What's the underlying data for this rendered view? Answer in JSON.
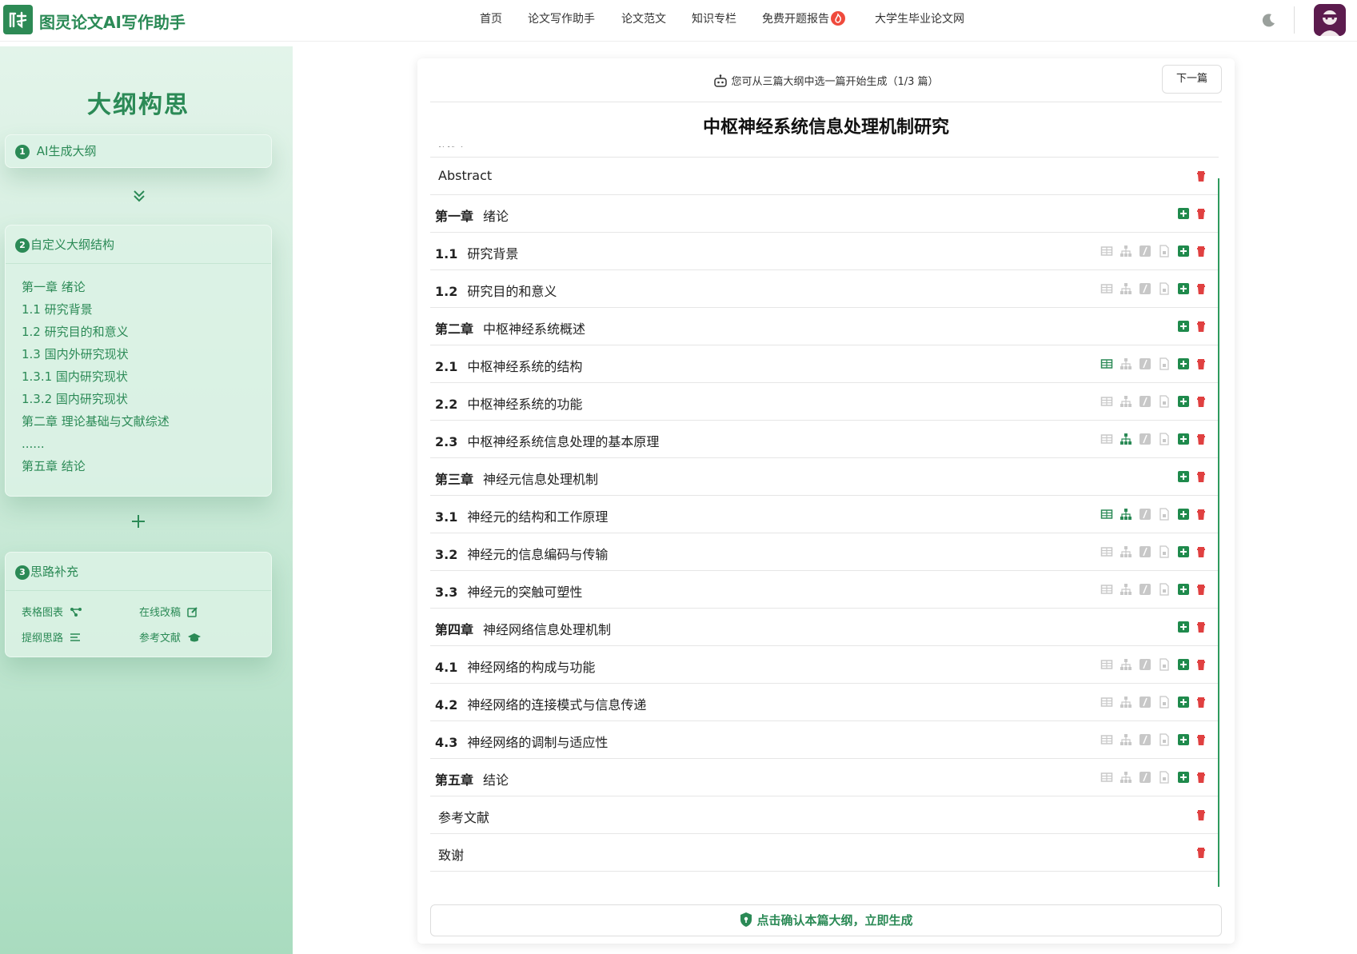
{
  "app": {
    "title": "图灵论文AI写作助手"
  },
  "nav": [
    "首页",
    "论文写作助手",
    "论文范文",
    "知识专栏",
    "免费开题报告",
    "大学生毕业论文网"
  ],
  "sidebar": {
    "title": "大纲构思",
    "step1": {
      "num": "1",
      "label": "AI生成大纲"
    },
    "step2": {
      "num": "2",
      "label": "自定义大纲结构",
      "items": [
        "第一章 绪论",
        "1.1 研究背景",
        "1.2 研究目的和意义",
        "1.3 国内外研究现状",
        "1.3.1 国内研究现状",
        "1.3.2 国内研究现状",
        "第二章 理论基础与文献综述",
        "......",
        "第五章 结论"
      ]
    },
    "step3": {
      "num": "3",
      "label": "思路补充",
      "links": [
        "表格图表",
        "在线改稿",
        "提纲思路",
        "参考文献"
      ]
    }
  },
  "main": {
    "hint": "您可从三篇大纲中选一篇开始生成（1/3 篇）",
    "next_button": "下一篇",
    "paper_title": "中枢神经系统信息处理机制研究",
    "rows": [
      {
        "num": "",
        "text": "摘要",
        "kind": "plain"
      },
      {
        "num": "",
        "text": "Abstract",
        "kind": "plain"
      },
      {
        "num": "第一章",
        "text": "绪论",
        "kind": "chapter"
      },
      {
        "num": "1.1",
        "text": "研究背景",
        "kind": "section"
      },
      {
        "num": "1.2",
        "text": "研究目的和意义",
        "kind": "section"
      },
      {
        "num": "第二章",
        "text": "中枢神经系统概述",
        "kind": "chapter"
      },
      {
        "num": "2.1",
        "text": "中枢神经系统的结构",
        "kind": "section"
      },
      {
        "num": "2.2",
        "text": "中枢神经系统的功能",
        "kind": "section"
      },
      {
        "num": "2.3",
        "text": "中枢神经系统信息处理的基本原理",
        "kind": "section"
      },
      {
        "num": "第三章",
        "text": "神经元信息处理机制",
        "kind": "chapter"
      },
      {
        "num": "3.1",
        "text": "神经元的结构和工作原理",
        "kind": "section"
      },
      {
        "num": "3.2",
        "text": "神经元的信息编码与传输",
        "kind": "section"
      },
      {
        "num": "3.3",
        "text": "神经元的突触可塑性",
        "kind": "section"
      },
      {
        "num": "第四章",
        "text": "神经网络信息处理机制",
        "kind": "chapter"
      },
      {
        "num": "4.1",
        "text": "神经网络的构成与功能",
        "kind": "section"
      },
      {
        "num": "4.2",
        "text": "神经网络的连接模式与信息传递",
        "kind": "section"
      },
      {
        "num": "4.3",
        "text": "神经网络的调制与适应性",
        "kind": "section"
      },
      {
        "num": "第五章",
        "text": "结论",
        "kind": "section"
      },
      {
        "num": "",
        "text": "参考文献",
        "kind": "plain"
      },
      {
        "num": "",
        "text": "致谢",
        "kind": "plain"
      }
    ],
    "confirm_button": "点击确认本篇大纲，立即生成"
  },
  "colors": {
    "brand": "#2b8a56",
    "delete": "#e04040",
    "add": "#1f8a4c",
    "icon_idle": "#c8c8c8",
    "icon_active": "#2b8a56"
  },
  "icons": [
    "table-icon",
    "sitemap-icon",
    "formula-icon",
    "document-icon",
    "add-icon",
    "trash-icon"
  ]
}
